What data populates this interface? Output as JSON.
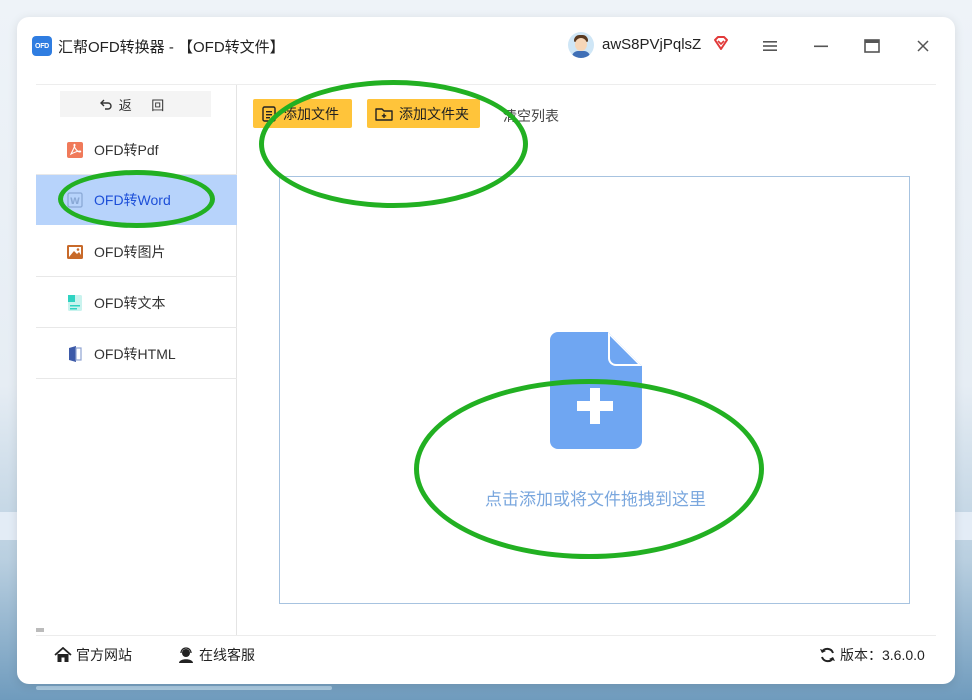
{
  "app": {
    "logo_text": "OFD",
    "title": "汇帮OFD转换器 - 【OFD转文件】"
  },
  "user": {
    "name": "awS8PVjPqlsZ"
  },
  "window_controls": {
    "icons": [
      "menu-icon",
      "minimize-icon",
      "maximize-icon",
      "close-icon"
    ]
  },
  "sidebar": {
    "back_label": "返 回",
    "items": [
      {
        "label": "OFD转Pdf",
        "icon": "pdf-icon",
        "active": false
      },
      {
        "label": "OFD转Word",
        "icon": "word-icon",
        "active": true
      },
      {
        "label": "OFD转图片",
        "icon": "image-icon",
        "active": false
      },
      {
        "label": "OFD转文本",
        "icon": "text-icon",
        "active": false
      },
      {
        "label": "OFD转HTML",
        "icon": "html-icon",
        "active": false
      }
    ]
  },
  "toolbar": {
    "add_file_label": "添加文件",
    "add_folder_label": "添加文件夹",
    "clear_list_label": "清空列表"
  },
  "dropzone": {
    "hint": "点击添加或将文件拖拽到这里"
  },
  "footer": {
    "site_label": "官方网站",
    "support_label": "在线客服",
    "version_label": "版本：3.6.0.0"
  },
  "colors": {
    "accent_button": "#ffc43a",
    "active_nav_bg": "#b7d3fb",
    "active_nav_text": "#1d4fd8",
    "drop_icon": "#6fa6f2",
    "annotation": "#22b022"
  }
}
